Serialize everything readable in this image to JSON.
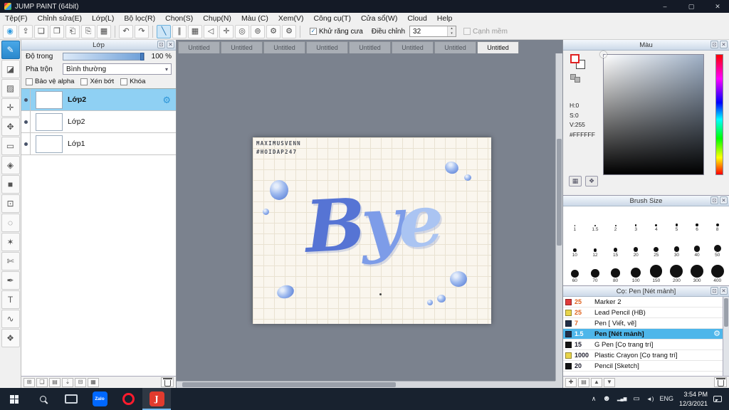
{
  "ui": {
    "min_glyph": "–",
    "max_glyph": "▢",
    "win_close_glyph": "✕",
    "float_glyph": "⊡",
    "close_glyph": "✕",
    "dropdown_glyph": "▾",
    "spin_up": "▴",
    "spin_down": "▾",
    "check_glyph": "✓",
    "gear_glyph": "⚙"
  },
  "titlebar": {
    "title": "JUMP PAINT (64bit)"
  },
  "menubar": {
    "items": [
      "Tệp(F)",
      "Chỉnh sửa(E)",
      "Lớp(L)",
      "Bộ lọc(R)",
      "Chọn(S)",
      "Chụp(N)",
      "Màu (C)",
      "Xem(V)",
      "Công cụ(T)",
      "Cửa sổ(W)",
      "Cloud",
      "Help"
    ]
  },
  "toolbar": {
    "group_a": [
      {
        "name": "brush-control-icon",
        "glyph": "◉",
        "color": "#2e9ae0"
      },
      {
        "name": "export-icon",
        "glyph": "⇪"
      },
      {
        "name": "comment-icon",
        "glyph": "❏"
      },
      {
        "name": "comment-filled-icon",
        "glyph": "❐"
      },
      {
        "name": "page-icon",
        "glyph": "⎗"
      },
      {
        "name": "pages-icon",
        "glyph": "⎘"
      },
      {
        "name": "panels-icon",
        "glyph": "▦"
      }
    ],
    "group_b": [
      {
        "name": "undo-icon",
        "glyph": "↶"
      },
      {
        "name": "redo-icon",
        "glyph": "↷"
      }
    ],
    "group_c": [
      {
        "name": "line-mode-icon",
        "glyph": "╲",
        "pressed": true
      },
      {
        "name": "parallel-lines-icon",
        "glyph": "∥"
      },
      {
        "name": "grid-snap-icon",
        "glyph": "▦"
      },
      {
        "name": "mirror-icon",
        "glyph": "◁"
      },
      {
        "name": "cross-snap-icon",
        "glyph": "✛"
      },
      {
        "name": "spiral-snap-icon",
        "glyph": "◎"
      },
      {
        "name": "concentric-snap-icon",
        "glyph": "⊚"
      },
      {
        "name": "snap-settings-icon",
        "glyph": "⚙"
      },
      {
        "name": "tool-settings-icon",
        "glyph": "⚙"
      }
    ],
    "antialias_label": "Khử răng cưa",
    "antialias_checked": true,
    "adjust_label": "Điều chỉnh",
    "adjust_value": "32",
    "soft_edge_label": "Cạnh mềm"
  },
  "side_tools": [
    {
      "name": "brush-tool",
      "glyph": "✎",
      "selected": true
    },
    {
      "name": "eraser-tool",
      "glyph": "◪"
    },
    {
      "name": "smudge-tool",
      "glyph": "▨"
    },
    {
      "name": "pen-tool",
      "glyph": "✛"
    },
    {
      "name": "move-tool",
      "glyph": "✥"
    },
    {
      "name": "rect-tool",
      "glyph": "▭"
    },
    {
      "name": "fill-tool",
      "glyph": "◈"
    },
    {
      "name": "gradient-tool",
      "glyph": "■"
    },
    {
      "name": "select-tool",
      "glyph": "⊡"
    },
    {
      "name": "lasso-tool",
      "glyph": "◌"
    },
    {
      "name": "magic-wand-tool",
      "glyph": "✶"
    },
    {
      "name": "snip-tool",
      "glyph": "✄"
    },
    {
      "name": "eyedropper-tool",
      "glyph": "✒"
    },
    {
      "name": "text-tool",
      "glyph": "T"
    },
    {
      "name": "curve-tool",
      "glyph": "∿"
    },
    {
      "name": "hand-tool",
      "glyph": "❖"
    }
  ],
  "layer_panel": {
    "title": "Lớp",
    "opacity_label": "Độ trong",
    "opacity_value": "100 %",
    "blend_label": "Pha trộn",
    "blend_value": "Bình thường",
    "options": [
      {
        "label": "Bảo vệ alpha"
      },
      {
        "label": "Xén bớt"
      },
      {
        "label": "Khóa"
      }
    ],
    "layers": [
      {
        "name": "Lớp2",
        "selected": true,
        "thumb": "thumb-art"
      },
      {
        "name": "Lớp2",
        "thumb": "thumb-checker"
      },
      {
        "name": "Lớp1",
        "thumb": "thumb-white"
      }
    ],
    "footer_icons": [
      {
        "name": "add-layer-icon",
        "glyph": "⊞"
      },
      {
        "name": "duplicate-layer-icon",
        "glyph": "❏"
      },
      {
        "name": "layer-folder-icon",
        "glyph": "▤"
      },
      {
        "name": "merge-down-icon",
        "glyph": "⇣"
      },
      {
        "name": "clear-layer-icon",
        "glyph": "⊟"
      },
      {
        "name": "layer-mask-icon",
        "glyph": "▦"
      }
    ]
  },
  "document_tabs": [
    {
      "label": "Untitled"
    },
    {
      "label": "Untitled"
    },
    {
      "label": "Untitled"
    },
    {
      "label": "Untitled"
    },
    {
      "label": "Untitled"
    },
    {
      "label": "Untitled"
    },
    {
      "label": "Untitled"
    },
    {
      "label": "Untitled",
      "active": true
    }
  ],
  "canvas": {
    "credit_line1": "MAXIMUSVENN",
    "credit_line2": "#HOIDAP247",
    "word": "Bye",
    "letters": [
      {
        "char": "B",
        "color": "#5674d4"
      },
      {
        "char": "y",
        "color": "#7d9ce8"
      },
      {
        "char": "e",
        "color": "#aac4f2"
      }
    ]
  },
  "color_panel": {
    "title": "Màu",
    "hsv": [
      {
        "label": "H:0"
      },
      {
        "label": "S:0"
      },
      {
        "label": "V:255"
      }
    ],
    "hex": "#FFFFFF",
    "buttons": [
      {
        "name": "palette-grid-icon",
        "glyph": "▦"
      },
      {
        "name": "palette-icon",
        "glyph": "❖"
      }
    ]
  },
  "brush_size_panel": {
    "title": "Brush Size",
    "sizes": [
      1,
      1.5,
      2,
      3,
      4,
      5,
      6,
      8,
      10,
      12,
      15,
      20,
      25,
      30,
      40,
      50,
      60,
      70,
      80,
      100,
      150,
      200,
      300,
      400
    ]
  },
  "brush_panel": {
    "title": "Cọ: Pen [Nét mảnh]",
    "brushes": [
      {
        "size": "25",
        "name": "Marker 2",
        "chip": "#e03a3a",
        "size_color": "#e06420"
      },
      {
        "size": "25",
        "name": "Lead Pencil (HB)",
        "chip": "#e8d44a",
        "size_color": "#e06420"
      },
      {
        "size": "7",
        "name": "Pen [ Viết, vẽ]",
        "chip": "#232f47",
        "size_color": "#e06420"
      },
      {
        "size": "1.5",
        "name": "Pen [Nét mảnh]",
        "chip": "#232f47",
        "selected": true,
        "size_color": "#ffffff"
      },
      {
        "size": "15",
        "name": "G Pen [Cọ trang trí]",
        "chip": "#141414"
      },
      {
        "size": "1000",
        "name": "Plastic Crayon [Cọ trang trí]",
        "chip": "#e8d44a"
      },
      {
        "size": "20",
        "name": "Pencil [Sketch]",
        "chip": "#141414"
      }
    ],
    "footer_icons": [
      {
        "name": "add-brush-icon",
        "glyph": "✚"
      },
      {
        "name": "brush-folder-icon",
        "glyph": "▤"
      },
      {
        "name": "brush-up-icon",
        "glyph": "▲"
      },
      {
        "name": "brush-down-icon",
        "glyph": "▼"
      }
    ]
  },
  "taskbar": {
    "zalo_label": "Zalo",
    "jump_label": "J",
    "tray": [
      {
        "name": "chevron-up-icon",
        "glyph": "∧",
        "size": "9px"
      },
      {
        "name": "people-icon",
        "glyph": "☻",
        "size": "11px"
      },
      {
        "name": "signal-icon",
        "glyph": "▂▄▆",
        "size": "6px"
      },
      {
        "name": "battery-icon",
        "glyph": "▭",
        "size": "10px"
      },
      {
        "name": "volume-icon",
        "glyph": "◄)",
        "size": "8px"
      }
    ],
    "lang": "ENG",
    "time": "3:54 PM",
    "date": "12/3/2021"
  }
}
